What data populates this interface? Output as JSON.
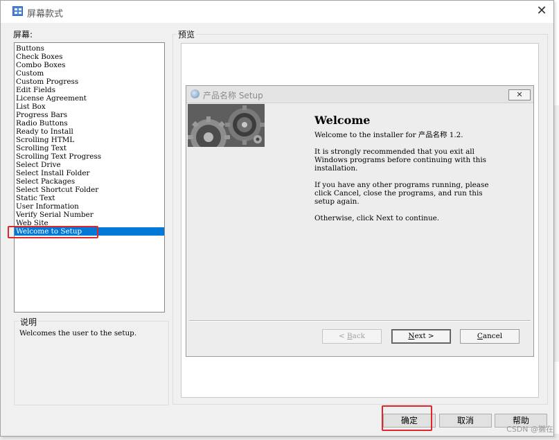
{
  "window": {
    "title": "屏幕款式",
    "close_glyph": "✕"
  },
  "screens_label": "屏幕:",
  "screens": [
    "Buttons",
    "Check Boxes",
    "Combo Boxes",
    "Custom",
    "Custom Progress",
    "Edit Fields",
    "License Agreement",
    "List Box",
    "Progress Bars",
    "Radio Buttons",
    "Ready to Install",
    "Scrolling HTML",
    "Scrolling Text",
    "Scrolling Text Progress",
    "Select Drive",
    "Select Install Folder",
    "Select Packages",
    "Select Shortcut Folder",
    "Static Text",
    "User Information",
    "Verify Serial Number",
    "Web Site",
    "Welcome to Setup"
  ],
  "selected_screen": "Welcome to Setup",
  "description": {
    "label": "说明",
    "text": "Welcomes the user to the setup."
  },
  "preview": {
    "label": "预览",
    "inner_title": "产品名称 Setup",
    "inner_close_glyph": "✕",
    "welcome_title": "Welcome",
    "lines": [
      "Welcome to the installer for 产品名称 1.2.",
      "It is strongly recommended that you exit all",
      "Windows programs before continuing with this",
      "installation.",
      "If you have any other programs running, please",
      "click Cancel, close the programs, and run this",
      "setup again.",
      "Otherwise, click Next to continue."
    ],
    "back": {
      "pre": "< ",
      "key": "B",
      "rest": "ack"
    },
    "next": {
      "key": "N",
      "rest": "ext >"
    },
    "cancel": {
      "key": "C",
      "rest": "ancel"
    }
  },
  "buttons": {
    "ok": "确定",
    "cancel": "取消",
    "help": "帮助"
  },
  "watermark": "CSDN @獭在"
}
